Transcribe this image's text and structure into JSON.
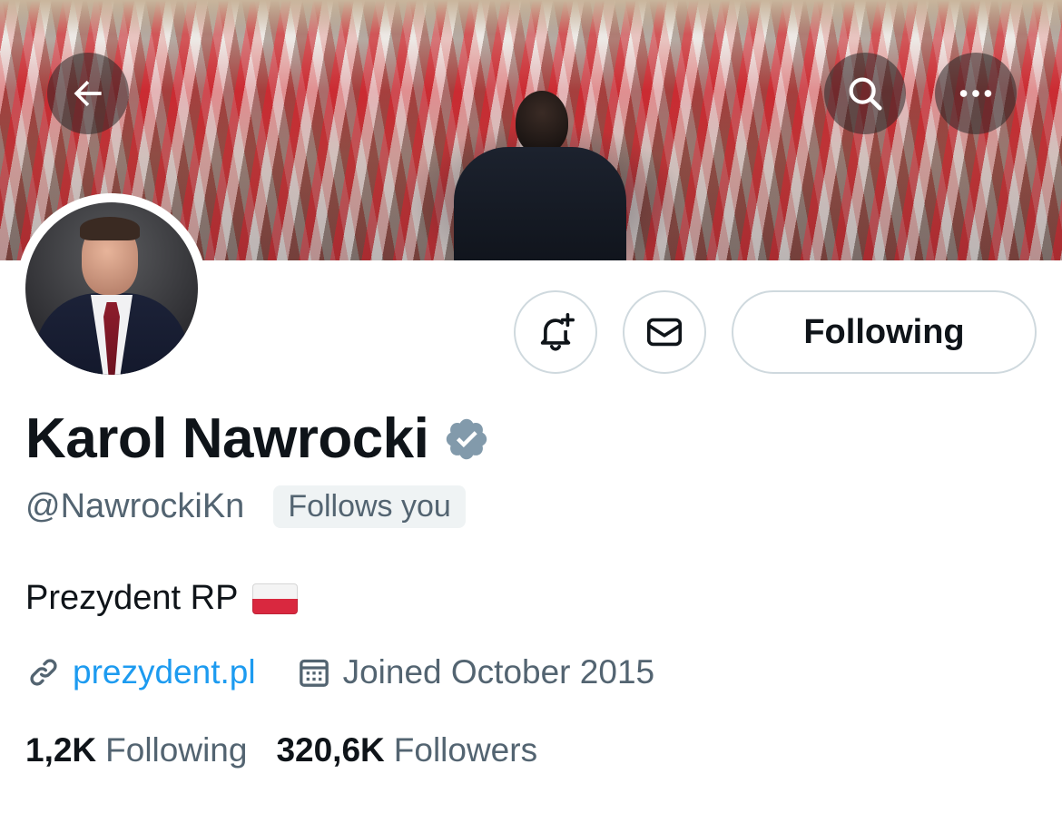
{
  "header": {
    "back_icon": "arrow-left-icon",
    "search_icon": "search-icon",
    "more_icon": "more-horizontal-icon"
  },
  "actions": {
    "notify_icon": "bell-plus-icon",
    "message_icon": "envelope-icon",
    "following_label": "Following"
  },
  "profile": {
    "display_name": "Karol Nawrocki",
    "verified_icon": "verified-badge-icon",
    "verified_color": "#829aab",
    "handle": "@NawrockiKn",
    "follows_you": "Follows you",
    "bio": "Prezydent RP",
    "bio_emoji": "flag-poland-icon",
    "website": "prezydent.pl",
    "joined": "Joined October 2015"
  },
  "stats": {
    "following_count": "1,2K",
    "following_label": "Following",
    "followers_count": "320,6K",
    "followers_label": "Followers"
  },
  "colors": {
    "link": "#1d9bf0",
    "secondary_text": "#536471",
    "primary_text": "#0f1419",
    "border": "#cfd9de"
  }
}
